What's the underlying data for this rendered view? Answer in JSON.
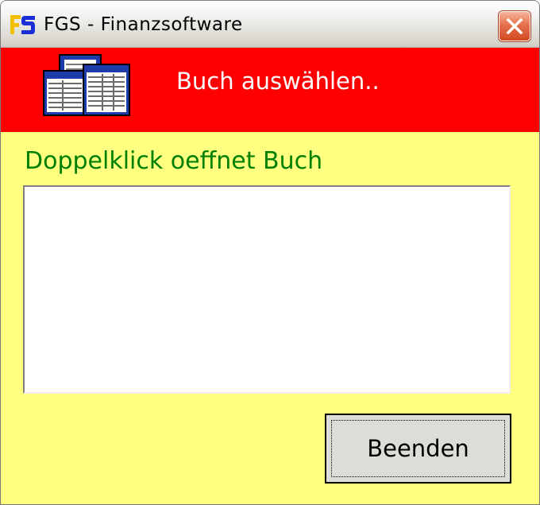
{
  "window": {
    "title": "FGS - Finanzsoftware",
    "app_icon": "fgs-logo-icon",
    "close_icon": "close-icon"
  },
  "banner": {
    "title": "Buch auswählen..",
    "icon": "books-icon",
    "color": "#ff0000"
  },
  "main": {
    "hint": "Doppelklick oeffnet Buch",
    "hint_color": "#008000",
    "background": "#ffff80",
    "book_list_items": []
  },
  "buttons": {
    "exit_label": "Beenden"
  }
}
